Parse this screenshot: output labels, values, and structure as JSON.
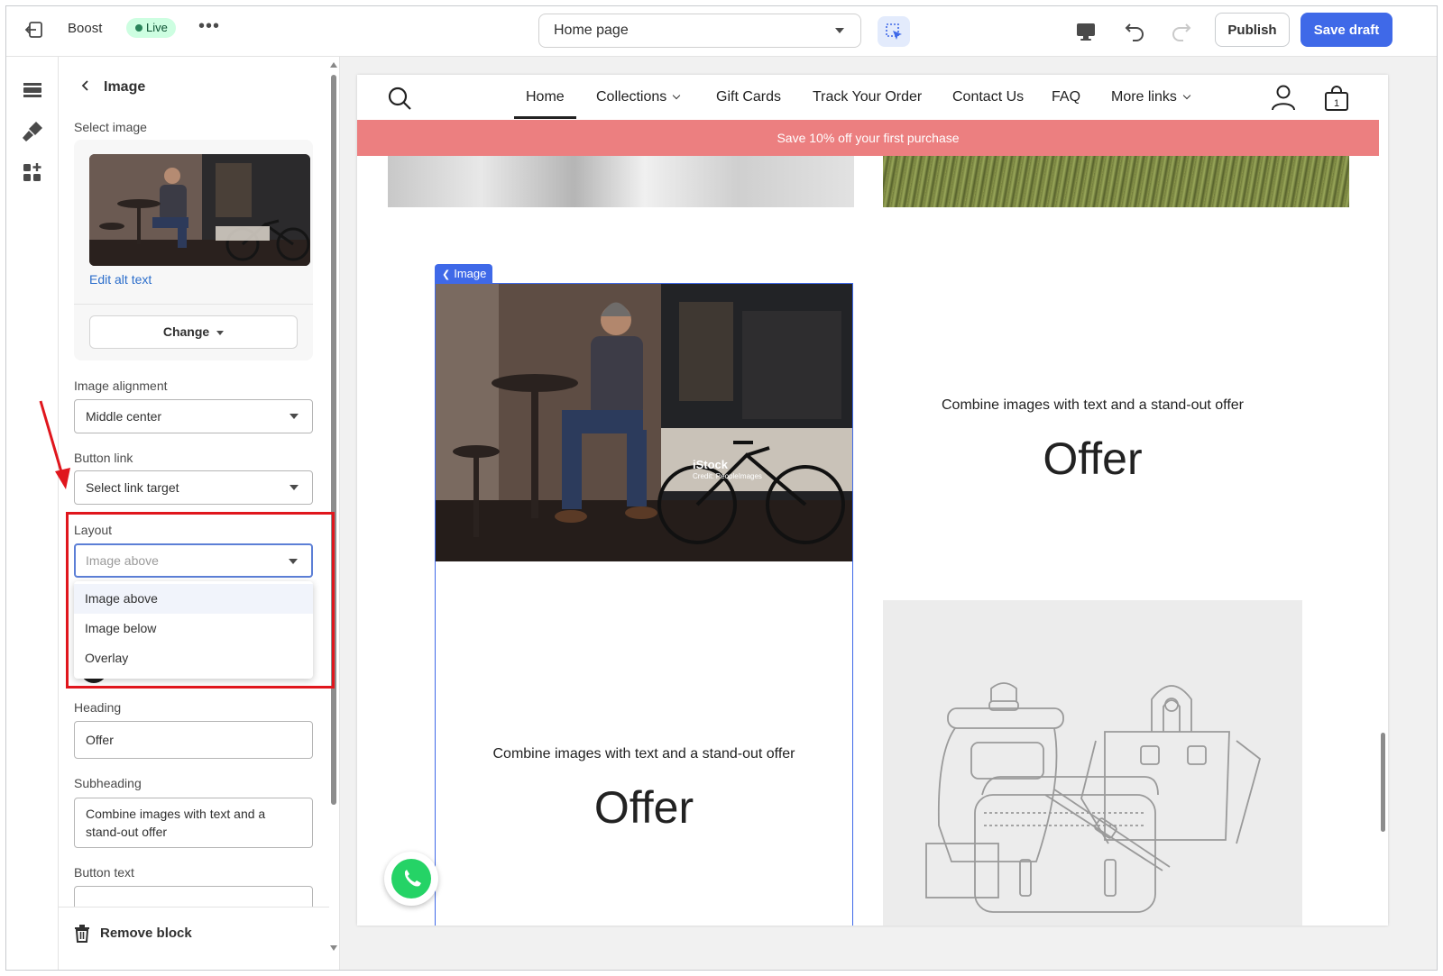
{
  "topbar": {
    "store_name": "Boost",
    "status_badge": "Live",
    "more_label": "•••",
    "page_selector": "Home page",
    "publish_label": "Publish",
    "save_label": "Save draft"
  },
  "panel": {
    "title": "Image",
    "select_image_label": "Select image",
    "edit_alt_text": "Edit alt text",
    "change_label": "Change",
    "image_alignment": {
      "label": "Image alignment",
      "value": "Middle center"
    },
    "button_link": {
      "label": "Button link",
      "value": "Select link target"
    },
    "layout": {
      "label": "Layout",
      "placeholder": "Image above",
      "options": [
        "Image above",
        "Image below",
        "Overlay"
      ]
    },
    "heading": {
      "label": "Heading",
      "value": "Offer"
    },
    "subheading": {
      "label": "Subheading",
      "value": "Combine images with text and a stand-out offer"
    },
    "button_text": {
      "label": "Button text",
      "value": ""
    },
    "remove_block": "Remove block"
  },
  "preview": {
    "nav": [
      "Home",
      "Collections",
      "Gift Cards",
      "Track Your Order",
      "Contact Us",
      "FAQ",
      "More links"
    ],
    "cart_count": "1",
    "banner": "Save 10% off your first purchase",
    "selected_tag": "Image",
    "blocks": [
      {
        "caption": "Combine images with text and a stand-out offer",
        "heading": "Offer"
      },
      {
        "caption": "Combine images with text and a stand-out offer",
        "heading": "Offer"
      }
    ],
    "photo_watermark": "iStock",
    "photo_credit": "Credit: PeopleImages"
  },
  "colors": {
    "accent": "#3f69e8",
    "banner": "#ec7f80",
    "live_badge_bg": "#cdfee1",
    "highlight_red": "#e0161d"
  }
}
